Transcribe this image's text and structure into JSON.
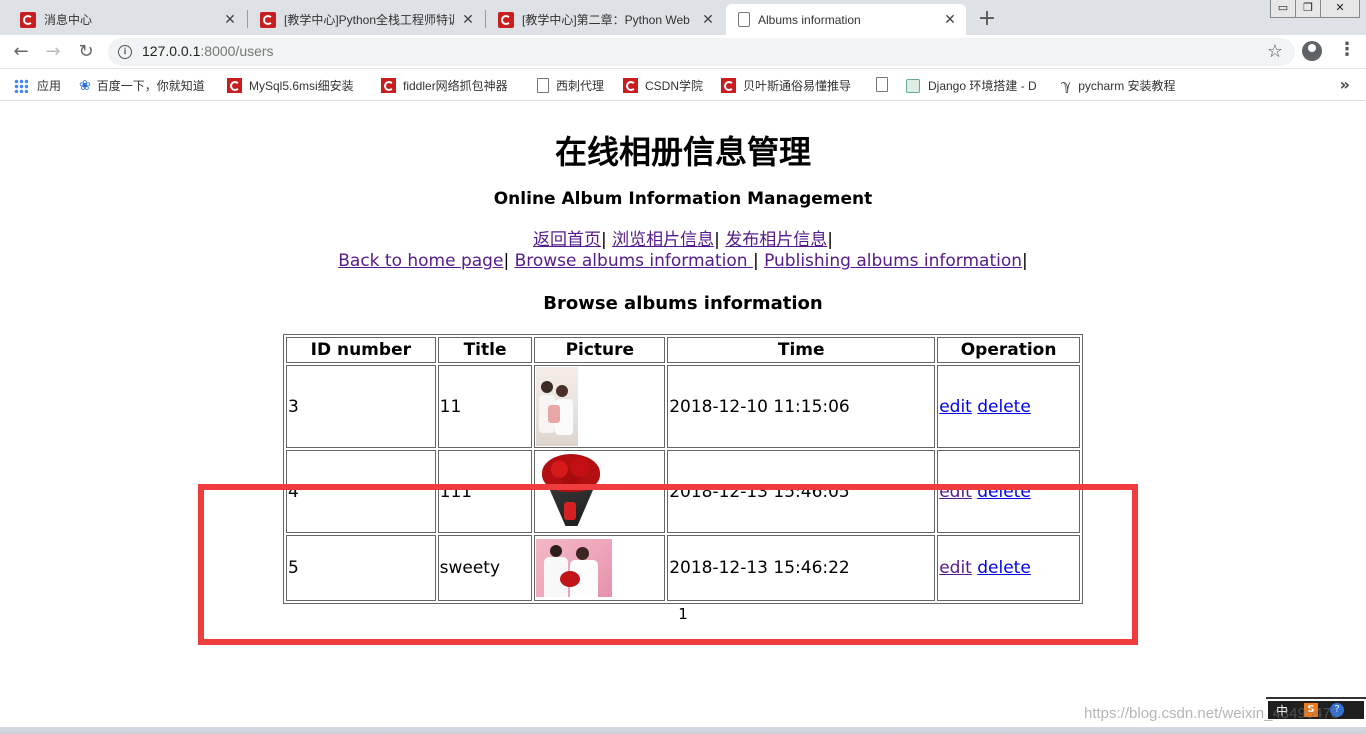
{
  "browser": {
    "tabs": [
      {
        "title": "消息中心",
        "icon": "csdn-c-icon"
      },
      {
        "title": "[教学中心]Python全栈工程师特训",
        "icon": "csdn-c-icon"
      },
      {
        "title": "[教学中心]第二章：Python Web",
        "icon": "csdn-c-icon"
      },
      {
        "title": "Albums information",
        "icon": "page-icon"
      }
    ],
    "close_glyph": "✕",
    "new_tab_glyph": "+",
    "window_controls": [
      "▭",
      "❐",
      "✕"
    ],
    "address": {
      "host": "127.0.0.1",
      "path": ":8000/users"
    },
    "bookmarks": [
      {
        "label": "应用",
        "icon": "apps-grid-icon"
      },
      {
        "label": "百度一下，你就知道",
        "icon": "baidu-paw-icon"
      },
      {
        "label": "MySql5.6msi细安装",
        "icon": "csdn-c-icon"
      },
      {
        "label": "fiddler网络抓包神器",
        "icon": "csdn-c-icon"
      },
      {
        "label": "西刺代理",
        "icon": "page-icon"
      },
      {
        "label": "CSDN学院",
        "icon": "csdn-c-icon"
      },
      {
        "label": "贝叶斯通俗易懂推导",
        "icon": "csdn-c-icon"
      },
      {
        "label": "",
        "icon": "page-icon"
      },
      {
        "label": "Django 环境搭建 - D",
        "icon": "globe-icon"
      },
      {
        "label": "pycharm 安装教程",
        "icon": "pycharm-icon"
      }
    ],
    "more_glyph": "»"
  },
  "page": {
    "heading_cn": "在线相册信息管理",
    "heading_en": "Online Album Information Management",
    "nav_cn": {
      "home": "返回首页",
      "browse": "浏览相片信息",
      "publish": "发布相片信息",
      "sep": "|"
    },
    "nav_en": {
      "home": "Back to home page",
      "browse": "Browse albums information ",
      "publish": "Publishing albums information",
      "sep": "|"
    },
    "section_title": "Browse albums information",
    "table": {
      "headers": [
        "ID number",
        "Title",
        "Picture",
        "Time",
        "Operation"
      ],
      "rows": [
        {
          "id": "3",
          "title": "11",
          "picture": "family-photo",
          "time": "2018-12-10 11:15:06",
          "edit": "edit",
          "delete": "delete"
        },
        {
          "id": "4",
          "title": "111",
          "picture": "rose-bouquet-photo",
          "time": "2018-12-13 15:46:05",
          "edit": "edit",
          "delete": "delete"
        },
        {
          "id": "5",
          "title": "sweety",
          "picture": "couple-photo",
          "time": "2018-12-13 15:46:22",
          "edit": "edit",
          "delete": "delete"
        }
      ]
    },
    "pagination": "1",
    "highlight_color": "#f03c3c"
  },
  "watermark": "https://blog.csdn.net/weixin_43495473",
  "ime": {
    "mode": "中",
    "s_logo": "S",
    "help": "?"
  }
}
